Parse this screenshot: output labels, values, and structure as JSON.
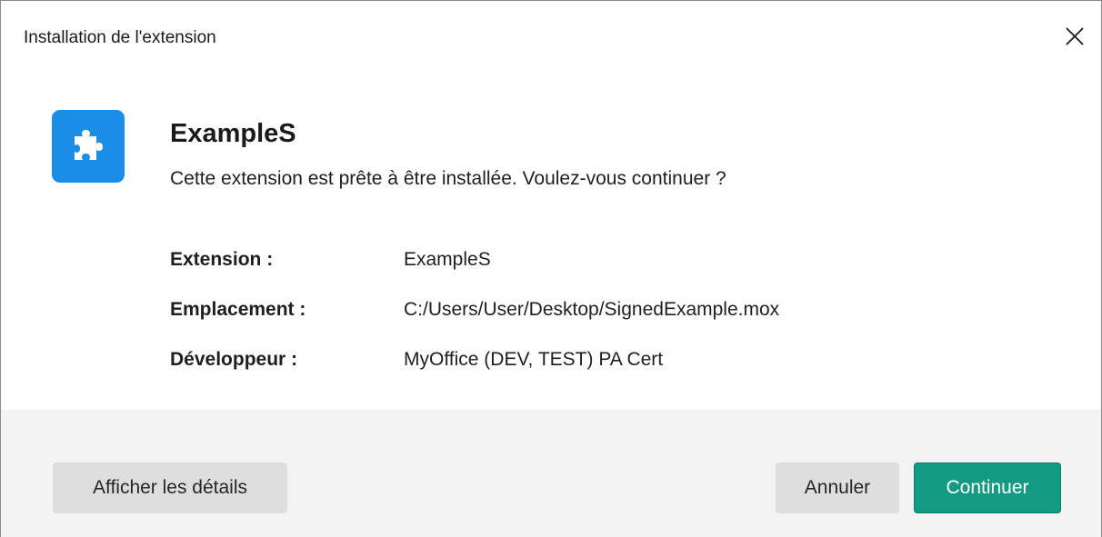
{
  "window": {
    "title": "Installation de l'extension",
    "close_icon": "close-icon"
  },
  "extension": {
    "icon": "puzzle-icon",
    "icon_color": "#1a8ee6",
    "name": "ExampleS",
    "message": "Cette extension est prête à être installée. Voulez-vous continuer ?"
  },
  "details": [
    {
      "label": "Extension :",
      "value": "ExampleS"
    },
    {
      "label": "Emplacement :",
      "value": "C:/Users/User/Desktop/SignedExample.mox"
    },
    {
      "label": "Développeur :",
      "value": "MyOffice (DEV, TEST) PA Cert"
    }
  ],
  "buttons": {
    "details_label": "Afficher les détails",
    "cancel_label": "Annuler",
    "continue_label": "Continuer",
    "continue_color": "#139a82"
  }
}
